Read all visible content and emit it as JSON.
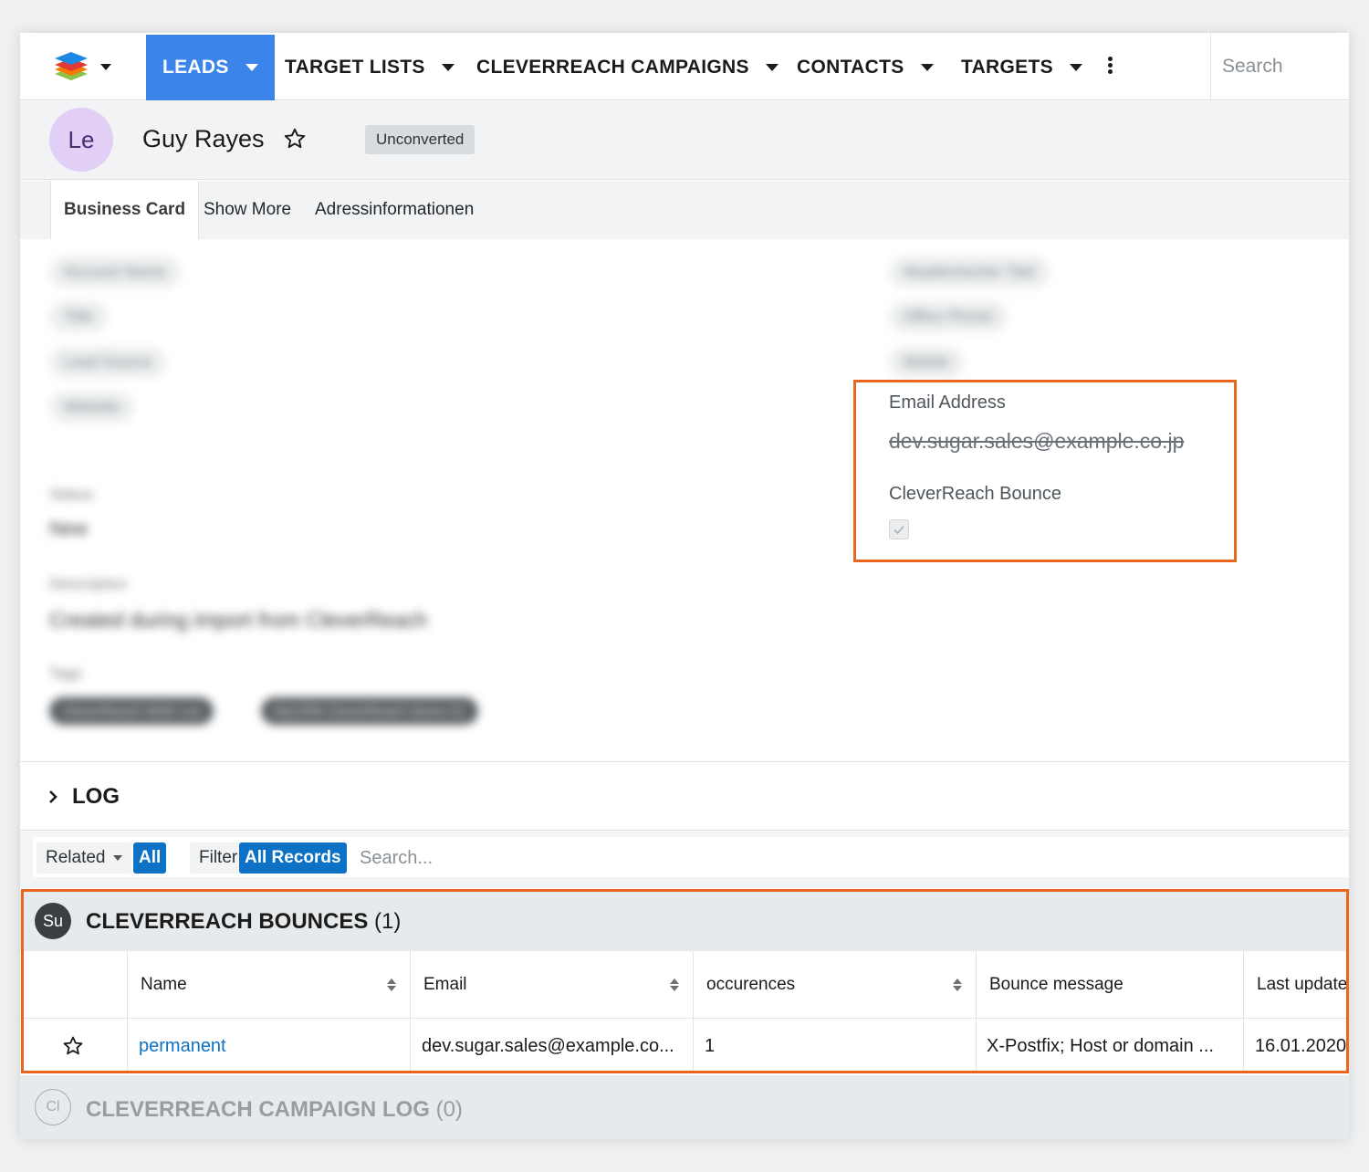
{
  "nav": {
    "items": [
      {
        "label": "LEADS",
        "active": true
      },
      {
        "label": "TARGET LISTS"
      },
      {
        "label": "CLEVERREACH CAMPAIGNS"
      },
      {
        "label": "CONTACTS"
      },
      {
        "label": "TARGETS"
      }
    ],
    "search_placeholder": "Search"
  },
  "record": {
    "avatar": "Le",
    "name": "Guy Rayes",
    "status_badge": "Unconverted"
  },
  "tabs": [
    "Business Card",
    "Show More",
    "Adressinformationen"
  ],
  "blurred_fields": {
    "left": [
      "Account Name",
      "Title",
      "Lead Source",
      "Website"
    ],
    "right": [
      "Akademischer Titel",
      "Office Phone",
      "Mobile"
    ],
    "status_label": "Status",
    "status_value": "New",
    "description_label": "Description",
    "description_value": "Created during import from CleverReach",
    "tags_label": "Tags",
    "tags": [
      "CleverReach 0000 List",
      "MyCRM CleverReach Demo 01"
    ]
  },
  "highlighted_fields": {
    "email_label": "Email Address",
    "email_value": "dev.sugar.sales@example.co.jp",
    "bounce_label": "CleverReach Bounce",
    "bounce_checked": true
  },
  "log": {
    "title": "LOG"
  },
  "related_bar": {
    "related_label": "Related",
    "all_label": "All",
    "filter_label": "Filter",
    "all_records_label": "All Records",
    "search_placeholder": "Search..."
  },
  "bounces_panel": {
    "icon": "Su",
    "title": "CLEVERREACH BOUNCES",
    "count": "(1)",
    "columns": [
      "Name",
      "Email",
      "occurences",
      "Bounce message",
      "Last update"
    ],
    "rows": [
      {
        "name": "permanent",
        "email": "dev.sugar.sales@example.co...",
        "occurences": "1",
        "bounce_message": "X-Postfix; Host or domain ...",
        "last_update": "16.01.2020"
      }
    ]
  },
  "campaign_log_panel": {
    "icon": "Cl",
    "title": "CLEVERREACH CAMPAIGN LOG",
    "count": "(0)"
  },
  "colors": {
    "accent": "#3a84ea",
    "link": "#0d72c6",
    "highlight": "#e8661d"
  }
}
